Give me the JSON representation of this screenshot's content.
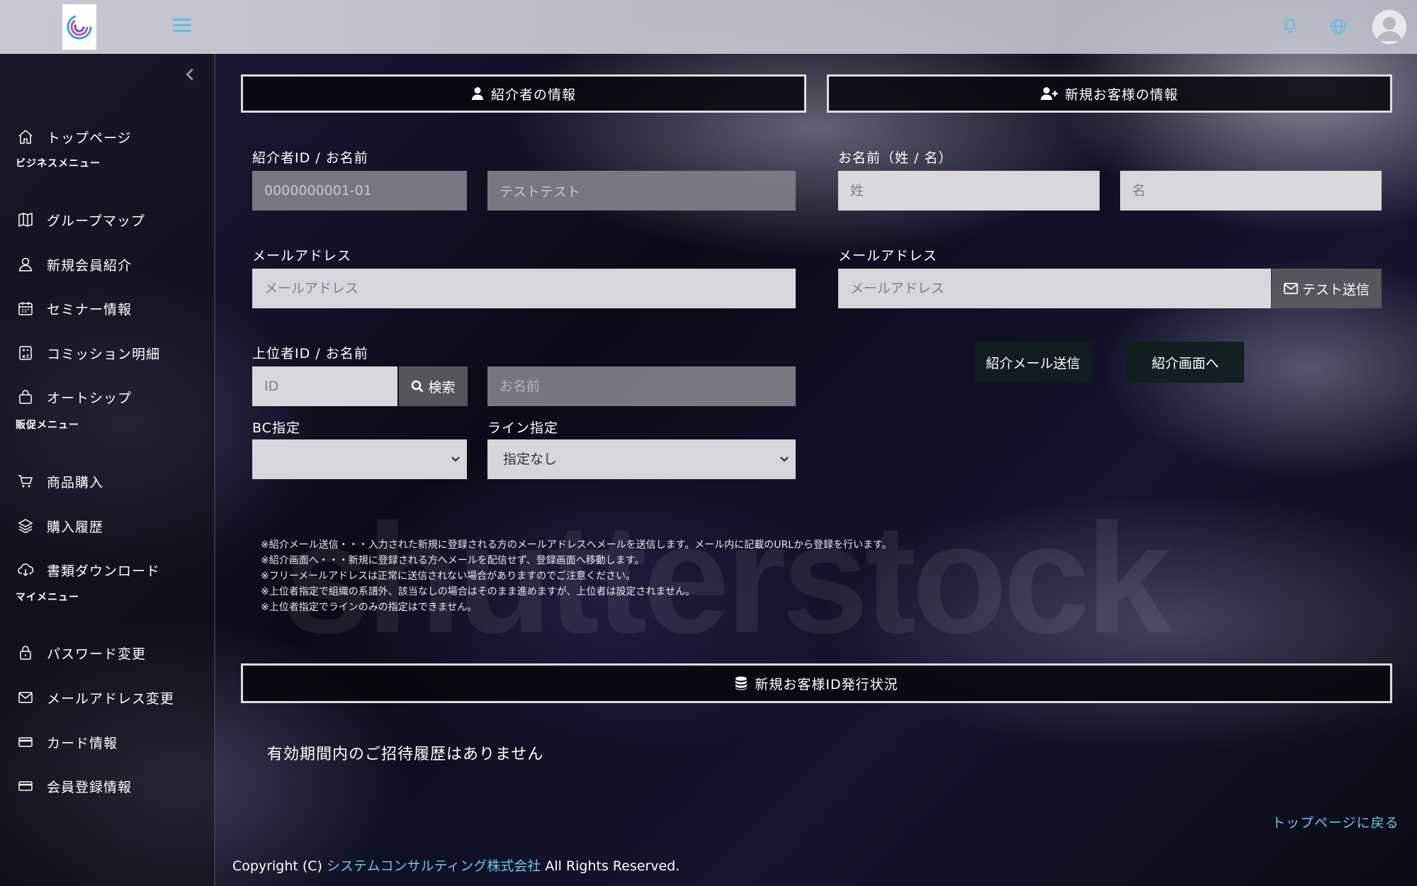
{
  "header": {
    "menu_icon": "hamburger-icon",
    "bell_icon": "bell-icon",
    "globe_icon": "globe-icon",
    "avatar_icon": "user-avatar-icon"
  },
  "sidebar": {
    "top_item": {
      "label": "トップページ",
      "icon": "home-icon"
    },
    "sections": [
      {
        "title": "ビジネスメニュー",
        "items": [
          {
            "label": "グループマップ",
            "icon": "map-icon"
          },
          {
            "label": "新規会員紹介",
            "icon": "user-icon"
          },
          {
            "label": "セミナー情報",
            "icon": "calendar-icon"
          },
          {
            "label": "コミッション明細",
            "icon": "calculator-icon"
          },
          {
            "label": "オートシップ",
            "icon": "bag-icon"
          }
        ]
      },
      {
        "title": "販促メニュー",
        "items": [
          {
            "label": "商品購入",
            "icon": "cart-icon"
          },
          {
            "label": "購入履歴",
            "icon": "layers-icon"
          },
          {
            "label": "書類ダウンロード",
            "icon": "cloud-download-icon"
          }
        ]
      },
      {
        "title": "マイメニュー",
        "items": [
          {
            "label": "パスワード変更",
            "icon": "lock-icon"
          },
          {
            "label": "メールアドレス変更",
            "icon": "mail-icon"
          },
          {
            "label": "カード情報",
            "icon": "credit-card-icon"
          },
          {
            "label": "会員登録情報",
            "icon": "card-icon"
          }
        ]
      }
    ]
  },
  "referrer_panel": {
    "title": "紹介者の情報",
    "id_name_label": "紹介者ID / お名前",
    "id_value": "0000000001-01",
    "name_value": "テストテスト",
    "email_label": "メールアドレス",
    "email_placeholder": "メールアドレス",
    "upline_label": "上位者ID / お名前",
    "upline_id_placeholder": "ID",
    "search_label": "検索",
    "upline_name_placeholder": "お名前",
    "bc_label": "BC指定",
    "bc_value": "",
    "line_label": "ライン指定",
    "line_value": "指定なし"
  },
  "customer_panel": {
    "title": "新規お客様の情報",
    "name_label": "お名前（姓 / 名）",
    "last_name_placeholder": "姓",
    "first_name_placeholder": "名",
    "email_label": "メールアドレス",
    "email_placeholder": "メールアドレス",
    "test_send_label": "テスト送信",
    "send_mail_label": "紹介メール送信",
    "to_page_label": "紹介画面へ"
  },
  "notes": [
    "※紹介メール送信・・・入力された新規に登録される方のメールアドレスへメールを送信します。メール内に記載のURLから登録を行います。",
    "※紹介画面へ・・・新規に登録される方へメールを配信せず、登録画面へ移動します。",
    "※フリーメールアドレスは正常に送信されない場合がありますのでご注意ください。",
    "※上位者指定で組織の系譜外、該当なしの場合はそのまま進めますが、上位者は設定されません。",
    "※上位者指定でラインのみの指定はできません。"
  ],
  "status_panel": {
    "title": "新規お客様ID発行状況",
    "empty_message": "有効期間内のご招待履歴はありません"
  },
  "back_link": "トップページに戻る",
  "footer": {
    "prefix": "Copyright (C) ",
    "company": "システムコンサルティング株式会社",
    "suffix": " All Rights Reserved."
  },
  "watermark": "shutterstock",
  "colors": {
    "accent": "#5bc0de",
    "link": "#6ec6e6"
  }
}
